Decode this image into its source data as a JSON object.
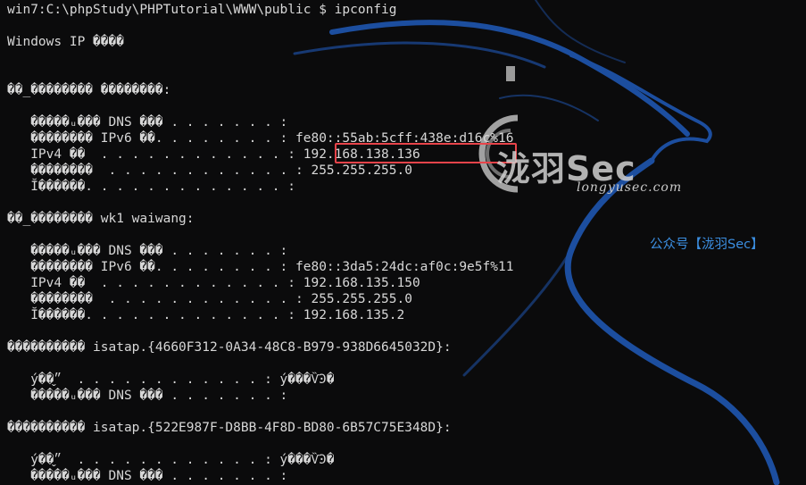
{
  "terminal": {
    "prompt": "win7:C:\\phpStudy\\PHPTutorial\\WWW\\public $ ipconfig",
    "lines": [
      "Windows IP ����",
      "��_�������� ��������:",
      "   �����ᵤ��� DNS ��� . . . . . . . :",
      "   �������� IPv6 ��. . . . . . . . : fe80::55ab:5cff:438e:d16c%16",
      "   IPv4 ��  . . . . . . . . . . . . : 192.168.138.136",
      "   ��������  . . . . . . . . . . . . : 255.255.255.0",
      "   Ĭ������. . . . . . . . . . . . . :",
      "��_�������� wk1 waiwang:",
      "   �����ᵤ��� DNS ��� . . . . . . . :",
      "   �������� IPv6 ��. . . . . . . . : fe80::3da5:24dc:af0c:9e5f%11",
      "   IPv4 ��  . . . . . . . . . . . . : 192.168.135.150",
      "   ��������  . . . . . . . . . . . . : 255.255.255.0",
      "   Ĭ������. . . . . . . . . . . . . : 192.168.135.2",
      "���������� isatap.{4660F312-0A34-48C8-B979-938D6645032D}:",
      "   ý��״̬  . . . . . . . . . . . . : ý���ѶϿ�",
      "   �����ᵤ��� DNS ��� . . . . . . . :",
      "���������� isatap.{522E987F-D8BB-4F8D-BD80-6B57C75E348D}:",
      "   ý��״̬  . . . . . . . . . . . . : ý���ѶϿ�",
      "   �����ᵤ��� DNS ��� . . . . . . . :"
    ]
  },
  "watermark": {
    "logo_text": "泷羽Sec",
    "url": "longyusec.com",
    "wechat": "公众号【泷羽Sec】"
  },
  "colors": {
    "background": "#0b0b0c",
    "text": "#d7d7d7",
    "highlight_box": "#e8444a",
    "wechat_text": "#3b8ee0",
    "dragon": "#1f56b0"
  },
  "icons": [
    "kali-dragon-icon",
    "longyu-logo-icon"
  ]
}
